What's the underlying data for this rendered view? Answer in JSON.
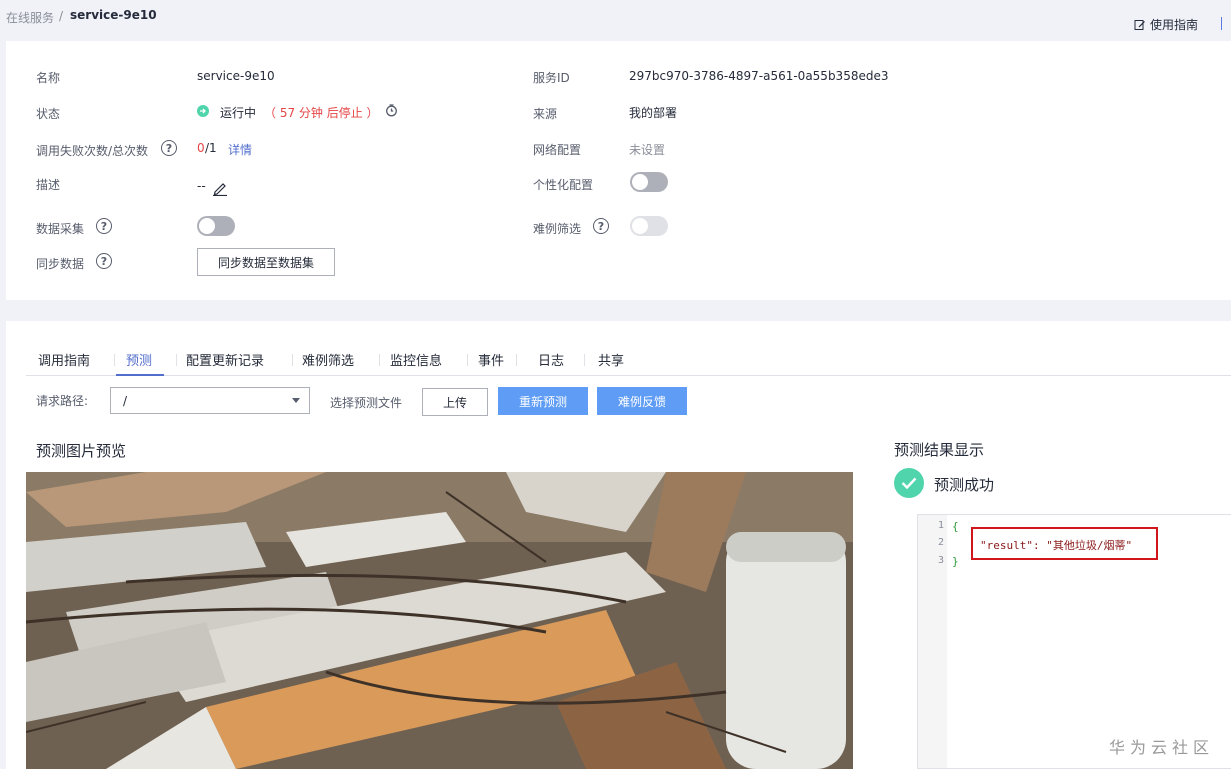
{
  "breadcrumb": {
    "parent": "在线服务",
    "separator": "/",
    "current": "service-9e10"
  },
  "header": {
    "guide_label": "使用指南"
  },
  "info": {
    "name_label": "名称",
    "name_value": "service-9e10",
    "service_id_label": "服务ID",
    "service_id_value": "297bc970-3786-4897-a561-0a55b358ede3",
    "status_label": "状态",
    "status_value": "运行中",
    "status_note": "（ 57 分钟 后停止 ）",
    "source_label": "来源",
    "source_value": "我的部署",
    "calls_label": "调用失败次数/总次数",
    "calls_fail": "0",
    "calls_total": "/1",
    "calls_detail": "详情",
    "network_label": "网络配置",
    "network_value": "未设置",
    "desc_label": "描述",
    "desc_value": "--",
    "custom_label": "个性化配置",
    "collect_label": "数据采集",
    "hard_label": "难例筛选",
    "sync_label": "同步数据",
    "sync_button": "同步数据至数据集"
  },
  "tabs": [
    "调用指南",
    "预测",
    "配置更新记录",
    "难例筛选",
    "监控信息",
    "事件",
    "日志",
    "共享"
  ],
  "predict": {
    "path_label": "请求路径:",
    "path_value": "/",
    "file_label": "选择预测文件",
    "upload_button": "上传",
    "repredict_button": "重新预测",
    "feedback_button": "难例反馈",
    "preview_title": "预测图片预览",
    "result_title": "预测结果显示",
    "success_label": "预测成功",
    "code_lines": [
      "{",
      "\"result\": \"其他垃圾/烟蒂\"",
      "}"
    ],
    "line_numbers": [
      "1",
      "2",
      "3"
    ]
  },
  "watermark": "华为云社区",
  "colors": {
    "accent": "#526ecc",
    "button_blue": "#5e9cf5",
    "success": "#50d4ab",
    "danger": "#d0161b",
    "running": "#50d4ab"
  }
}
